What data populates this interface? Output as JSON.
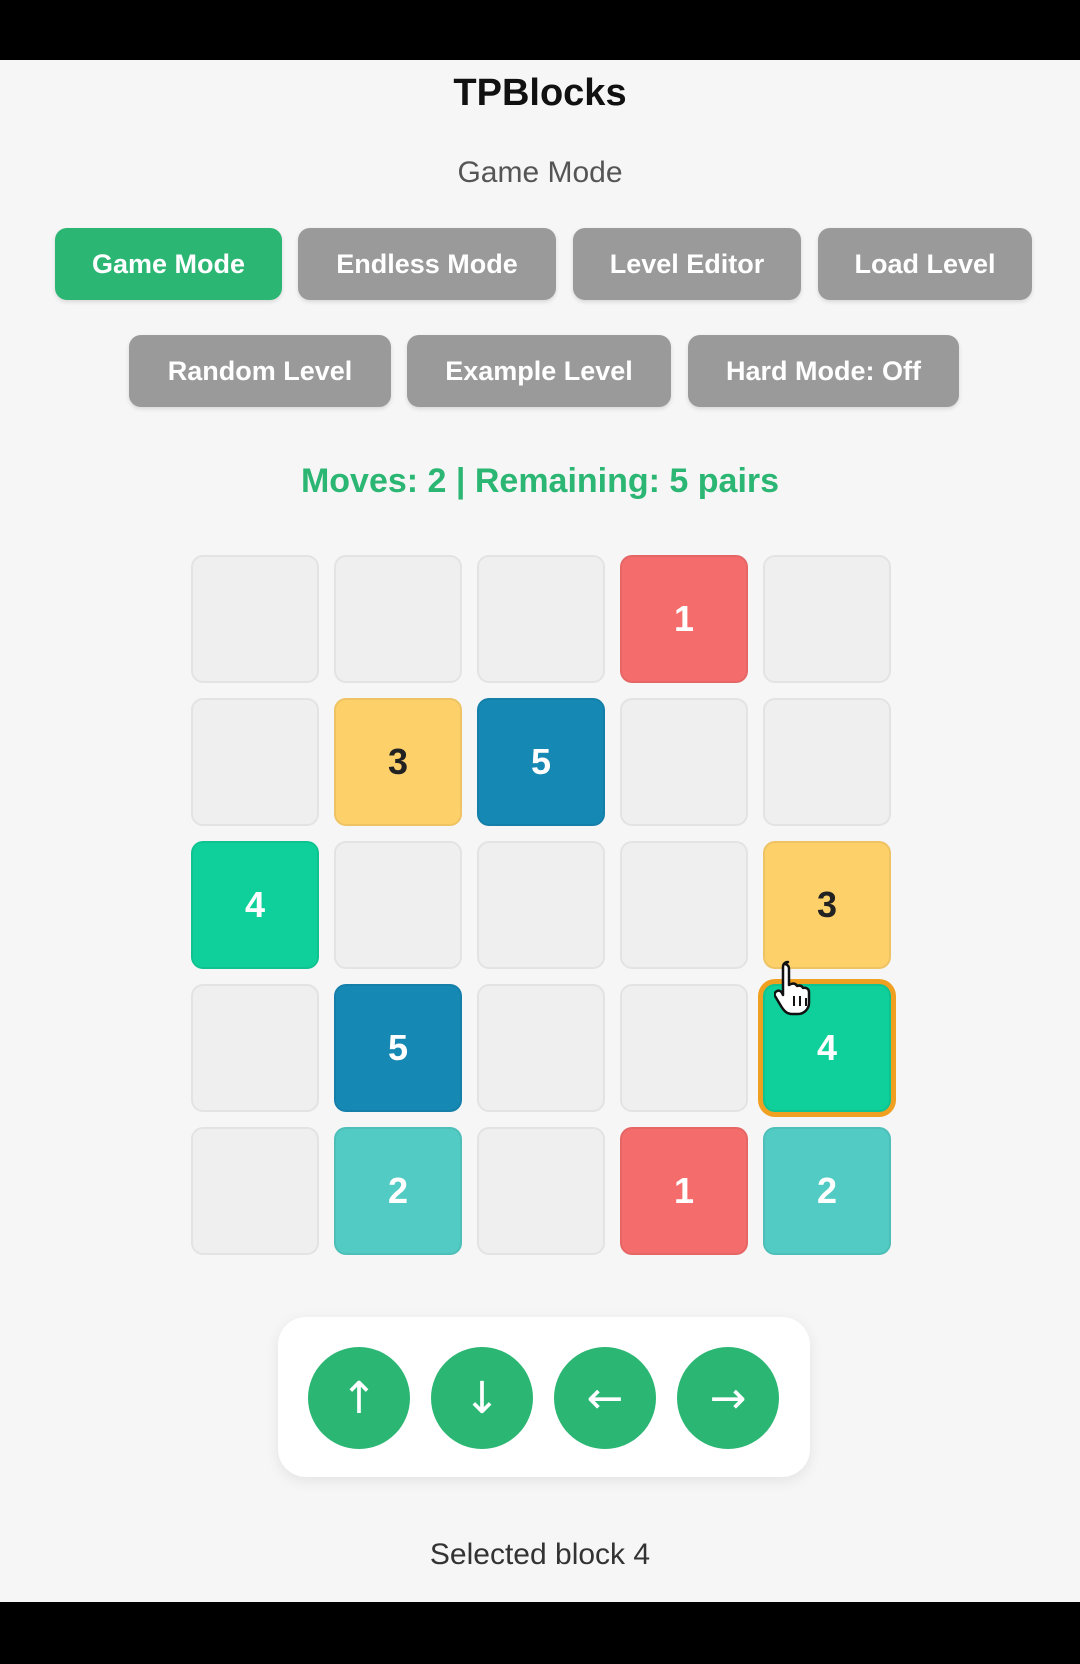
{
  "app": {
    "title": "TPBlocks",
    "mode_label": "Game Mode"
  },
  "toolbar": {
    "game_mode": "Game Mode",
    "endless_mode": "Endless Mode",
    "level_editor": "Level Editor",
    "load_level": "Load Level",
    "random_level": "Random Level",
    "example_level": "Example Level",
    "hard_mode": "Hard Mode: Off"
  },
  "status": {
    "text": "Moves: 2 | Remaining: 5 pairs"
  },
  "board": {
    "rows": [
      [
        "",
        "",
        "",
        "1",
        ""
      ],
      [
        "",
        "3",
        "5",
        "",
        ""
      ],
      [
        "4",
        "",
        "",
        "",
        "3"
      ],
      [
        "",
        "5",
        "",
        "",
        "4"
      ],
      [
        "",
        "2",
        "",
        "1",
        "2"
      ]
    ],
    "selected": {
      "row": 3,
      "col": 4
    }
  },
  "block_colors": {
    "1": "#f56c6c",
    "2": "#52cbc4",
    "3": "#fdd06a",
    "4": "#0fd09a",
    "5": "#1688b4",
    "empty": "#efefef"
  },
  "controls": {
    "up": "↑",
    "down": "↓",
    "left": "←",
    "right": "→"
  },
  "footer": {
    "message": "Selected block 4"
  },
  "colors": {
    "accent": "#2bb673",
    "button_inactive": "#9a9a9a",
    "selection": "#f0a020"
  }
}
